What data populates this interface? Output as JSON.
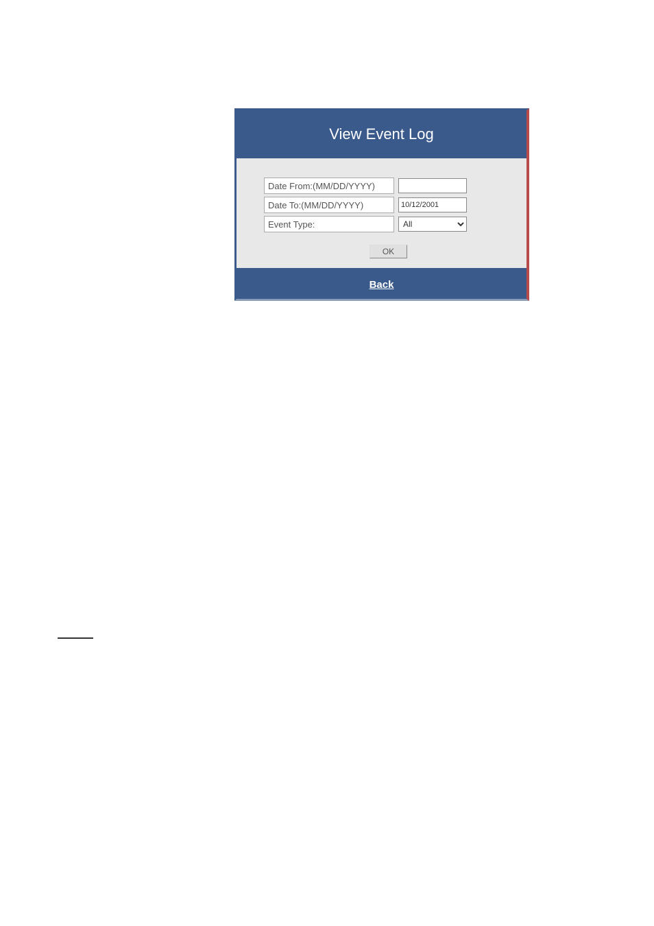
{
  "dialog": {
    "title": "View Event Log",
    "fields": {
      "date_from_label": "Date From:(MM/DD/YYYY)",
      "date_from_value": "",
      "date_to_label": "Date To:(MM/DD/YYYY)",
      "date_to_value": "10/12/2001",
      "event_type_label": "Event Type:",
      "event_type_value": "All"
    },
    "ok_label": "OK",
    "back_label": "Back"
  }
}
